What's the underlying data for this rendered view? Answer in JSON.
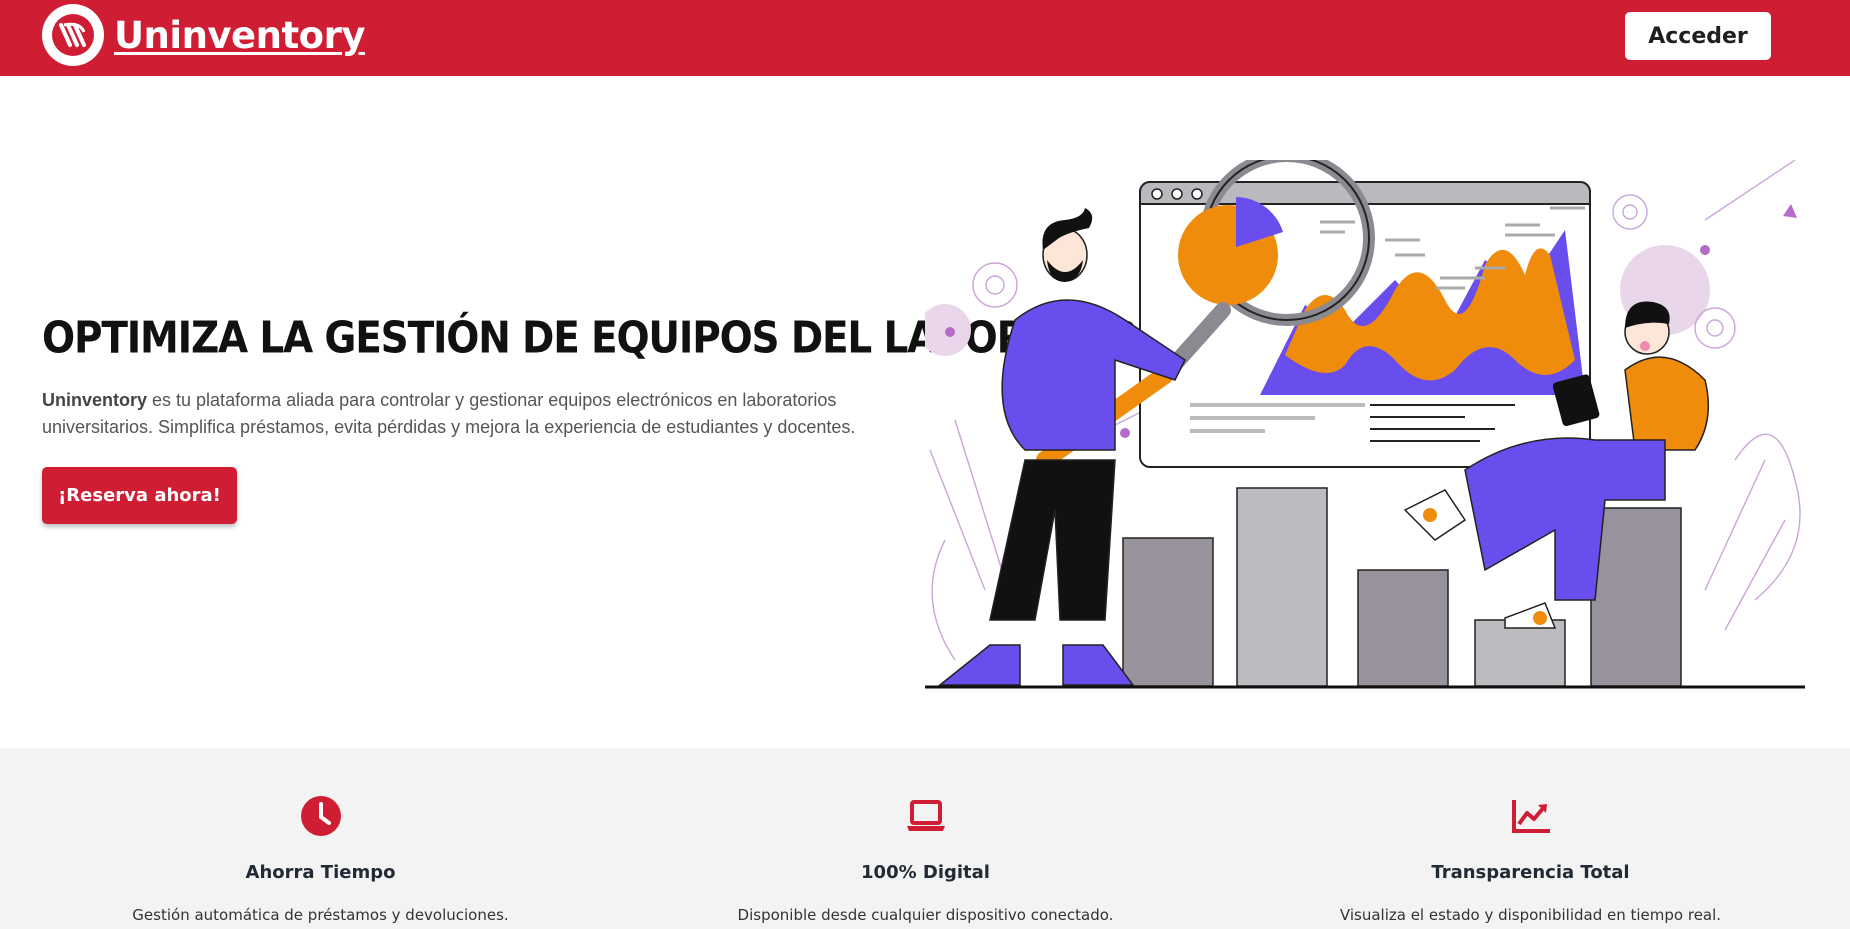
{
  "header": {
    "brand_name": "Uninventory",
    "login_label": "Acceder",
    "accent_color": "#cf1e33"
  },
  "hero": {
    "title": "OPTIMIZA LA GESTIÓN DE EQUIPOS DEL LABORATORIO",
    "description_brand": "Uninventory",
    "description_rest": " es tu plataforma aliada para controlar y gestionar equipos electrónicos en laboratorios universitarios. Simplifica préstamos, evita pérdidas y mejora la experiencia de estudiantes y docentes.",
    "cta_label": "¡Reserva ahora!"
  },
  "features": [
    {
      "icon": "clock-icon",
      "title": "Ahorra Tiempo",
      "description": "Gestión automática de préstamos y devoluciones."
    },
    {
      "icon": "laptop-icon",
      "title": "100% Digital",
      "description": "Disponible desde cualquier dispositivo conectado."
    },
    {
      "icon": "trend-chart-icon",
      "title": "Transparencia Total",
      "description": "Visualiza el estado y disponibilidad en tiempo real."
    }
  ]
}
